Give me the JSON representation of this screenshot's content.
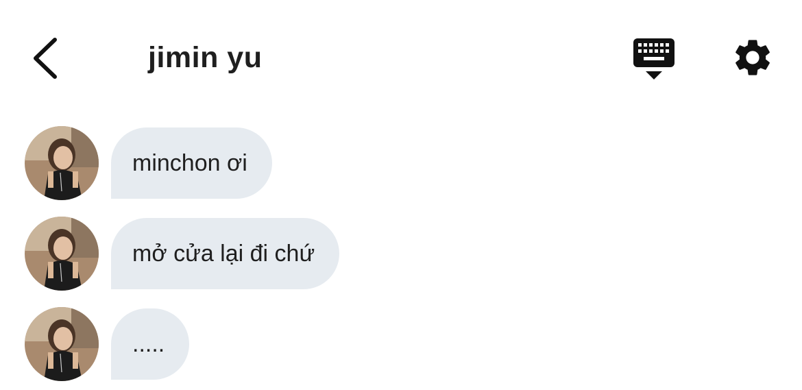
{
  "header": {
    "title": "jimin yu",
    "back_icon": "chevron-left-icon",
    "keyboard_icon": "keyboard-hide-icon",
    "settings_icon": "gear-icon"
  },
  "messages": [
    {
      "text": "minchon ơi"
    },
    {
      "text": "mở cửa lại đi chứ"
    },
    {
      "text": "....."
    }
  ],
  "colors": {
    "bubble_bg": "#e6ebf0",
    "text": "#1f1f1f",
    "icon": "#111111"
  }
}
